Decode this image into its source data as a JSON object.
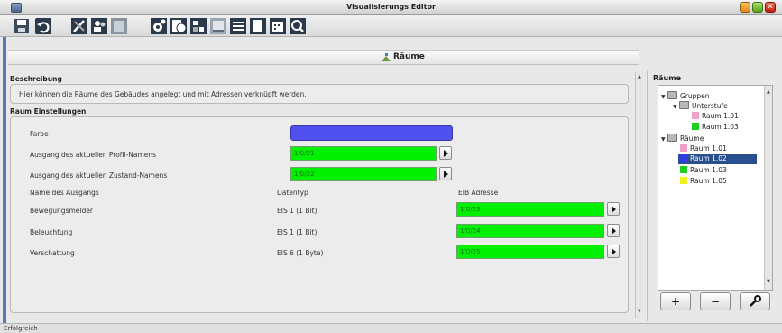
{
  "window": {
    "title": "Visualisierungs Editor"
  },
  "header": {
    "title": "Räume"
  },
  "beschreibung": {
    "heading": "Beschreibung",
    "text": "Hier können die Räume des Gebäudes angelegt und mit Adressen verknüpft werden."
  },
  "settings": {
    "heading": "Raum Einstellungen",
    "farbe_label": "Farbe",
    "farbe_color": "#5050f0",
    "profil_label": "Ausgang des aktuellen Profil-Namens",
    "profil_value": "1/0/21",
    "zustand_label": "Ausgang des aktuellen Zustand-Namens",
    "zustand_value": "1/0/22",
    "col_name": "Name des Ausgangs",
    "col_type": "Datentyp",
    "col_addr": "EIB Adresse",
    "rows": [
      {
        "name": "Bewegungsmelder",
        "type": "EIS 1 (1 Bit)",
        "addr": "1/0/23"
      },
      {
        "name": "Beleuchtung",
        "type": "EIS 1 (1 Bit)",
        "addr": "1/0/24"
      },
      {
        "name": "Verschattung",
        "type": "EIS 6 (1 Byte)",
        "addr": "1/0/25"
      }
    ]
  },
  "right": {
    "heading": "Räume",
    "tree": {
      "gruppen": "Gruppen",
      "unterstufe": "Unterstufe",
      "unterstufe_items": [
        {
          "label": "Raum 1.01",
          "color": "#f0a0c8"
        },
        {
          "label": "Raum 1.03",
          "color": "#20d020"
        }
      ],
      "raeume": "Räume",
      "raeume_items": [
        {
          "label": "Raum 1.01",
          "color": "#f0a0c8"
        },
        {
          "label": "Raum 1.02",
          "color": "#3040e0"
        },
        {
          "label": "Raum 1.03",
          "color": "#20d020"
        },
        {
          "label": "Raum 1.05",
          "color": "#f0f020"
        }
      ],
      "selected": "Raum 1.02"
    },
    "buttons": {
      "add": "+",
      "remove": "−"
    }
  },
  "status": {
    "text": "Erfolgreich"
  }
}
